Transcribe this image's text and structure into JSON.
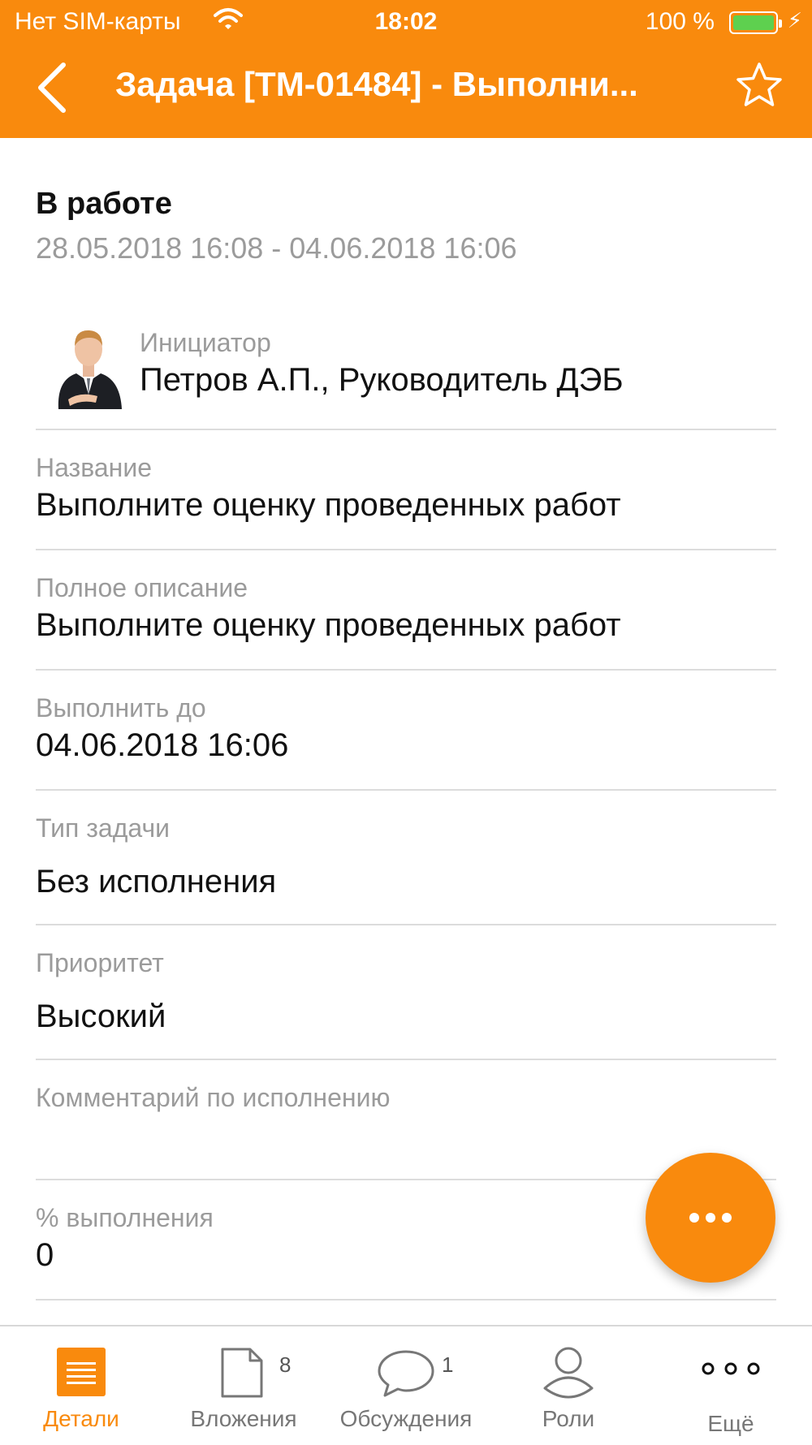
{
  "status_bar": {
    "carrier": "Нет SIM-карты",
    "time": "18:02",
    "battery": "100 %"
  },
  "nav": {
    "title": "Задача [ТМ-01484] - Выполни..."
  },
  "state": {
    "title": "В работе",
    "dates": "28.05.2018 16:08 - 04.06.2018 16:06"
  },
  "initiator": {
    "label": "Инициатор",
    "value": "Петров А.П., Руководитель ДЭБ"
  },
  "fields": {
    "name": {
      "label": "Название",
      "value": "Выполните оценку проведенных работ"
    },
    "description": {
      "label": "Полное описание",
      "value": "Выполните оценку проведенных работ"
    },
    "deadline": {
      "label": "Выполнить до",
      "value": "04.06.2018 16:06"
    },
    "task_type": {
      "label": "Тип задачи",
      "value": "Без исполнения"
    },
    "priority": {
      "label": "Приоритет",
      "value": "Высокий"
    },
    "comment": {
      "label": "Комментарий по исполнению",
      "value": ""
    },
    "percent": {
      "label": "% выполнения",
      "value": "0"
    }
  },
  "tabs": [
    {
      "label": "Детали",
      "icon": "details-icon",
      "badge": ""
    },
    {
      "label": "Вложения",
      "icon": "document-icon",
      "badge": "8"
    },
    {
      "label": "Обсуждения",
      "icon": "speech-bubble-icon",
      "badge": "1"
    },
    {
      "label": "Роли",
      "icon": "person-icon",
      "badge": ""
    },
    {
      "label": "Ещё",
      "icon": "more-icon",
      "badge": ""
    }
  ],
  "colors": {
    "accent": "#f98a0d",
    "muted_text": "#9b9b9b",
    "divider": "#dcdcdc"
  }
}
